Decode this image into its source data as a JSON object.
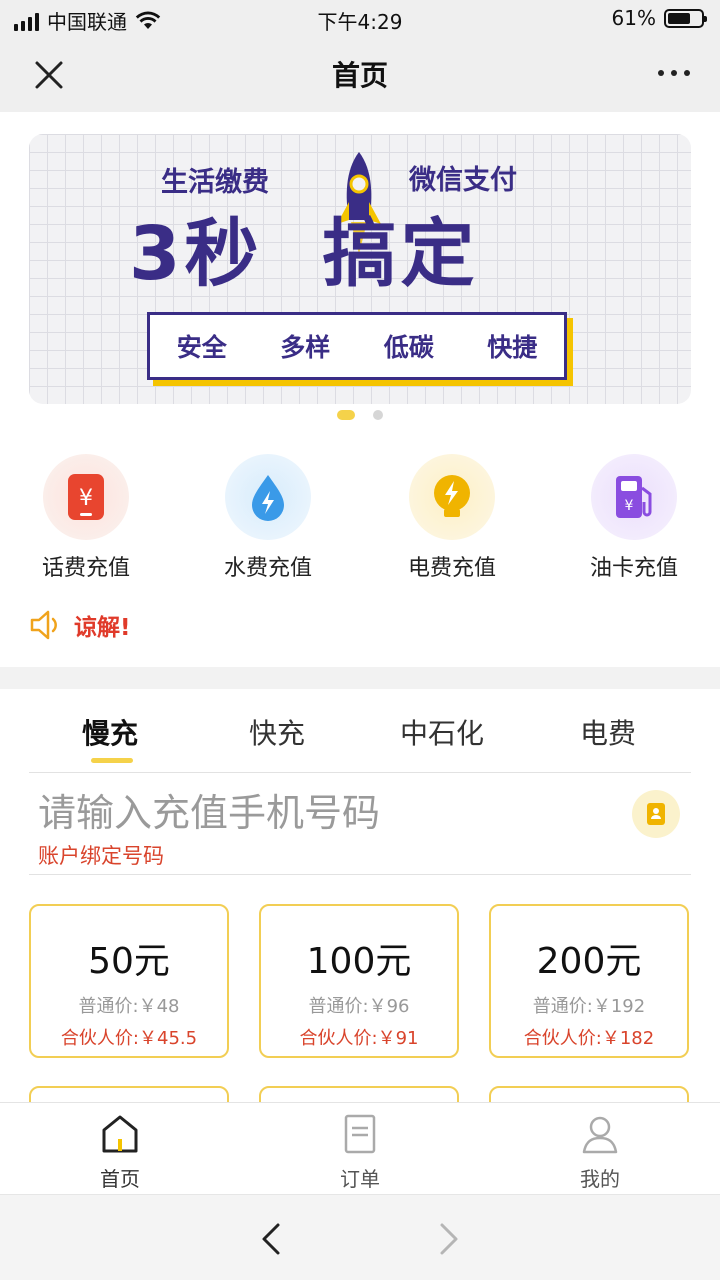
{
  "status_bar": {
    "carrier": "中国联通",
    "time": "下午4:29",
    "battery": "61%"
  },
  "nav": {
    "title": "首页"
  },
  "banner": {
    "tag_left": "生活缴费",
    "tag_right": "微信支付",
    "headline_a": "3秒",
    "headline_b": "搞定",
    "features": [
      "安全",
      "多样",
      "低碳",
      "快捷"
    ]
  },
  "services": [
    {
      "label": "话费充值",
      "icon": "phone-bill-icon",
      "color": "#e8452f"
    },
    {
      "label": "水费充值",
      "icon": "water-drop-icon",
      "color": "#3a9ae8"
    },
    {
      "label": "电费充值",
      "icon": "lightning-bulb-icon",
      "color": "#f0b400"
    },
    {
      "label": "油卡充值",
      "icon": "gas-pump-icon",
      "color": "#8a4de0"
    }
  ],
  "notice": {
    "text": "谅解!"
  },
  "tabs": [
    "慢充",
    "快充",
    "中石化",
    "电费"
  ],
  "recharge": {
    "placeholder": "请输入充值手机号码",
    "bind_label": "账户绑定号码"
  },
  "cards": [
    {
      "amount": "50元",
      "normal": "普通价:￥48",
      "partner": "合伙人价:￥45.5"
    },
    {
      "amount": "100元",
      "normal": "普通价:￥96",
      "partner": "合伙人价:￥91"
    },
    {
      "amount": "200元",
      "normal": "普通价:￥192",
      "partner": "合伙人价:￥182"
    }
  ],
  "tabbar": [
    "首页",
    "订单",
    "我的"
  ],
  "colors": {
    "accent": "#f5d24a",
    "price_red": "#d9442c",
    "banner_ink": "#3a2d86"
  }
}
